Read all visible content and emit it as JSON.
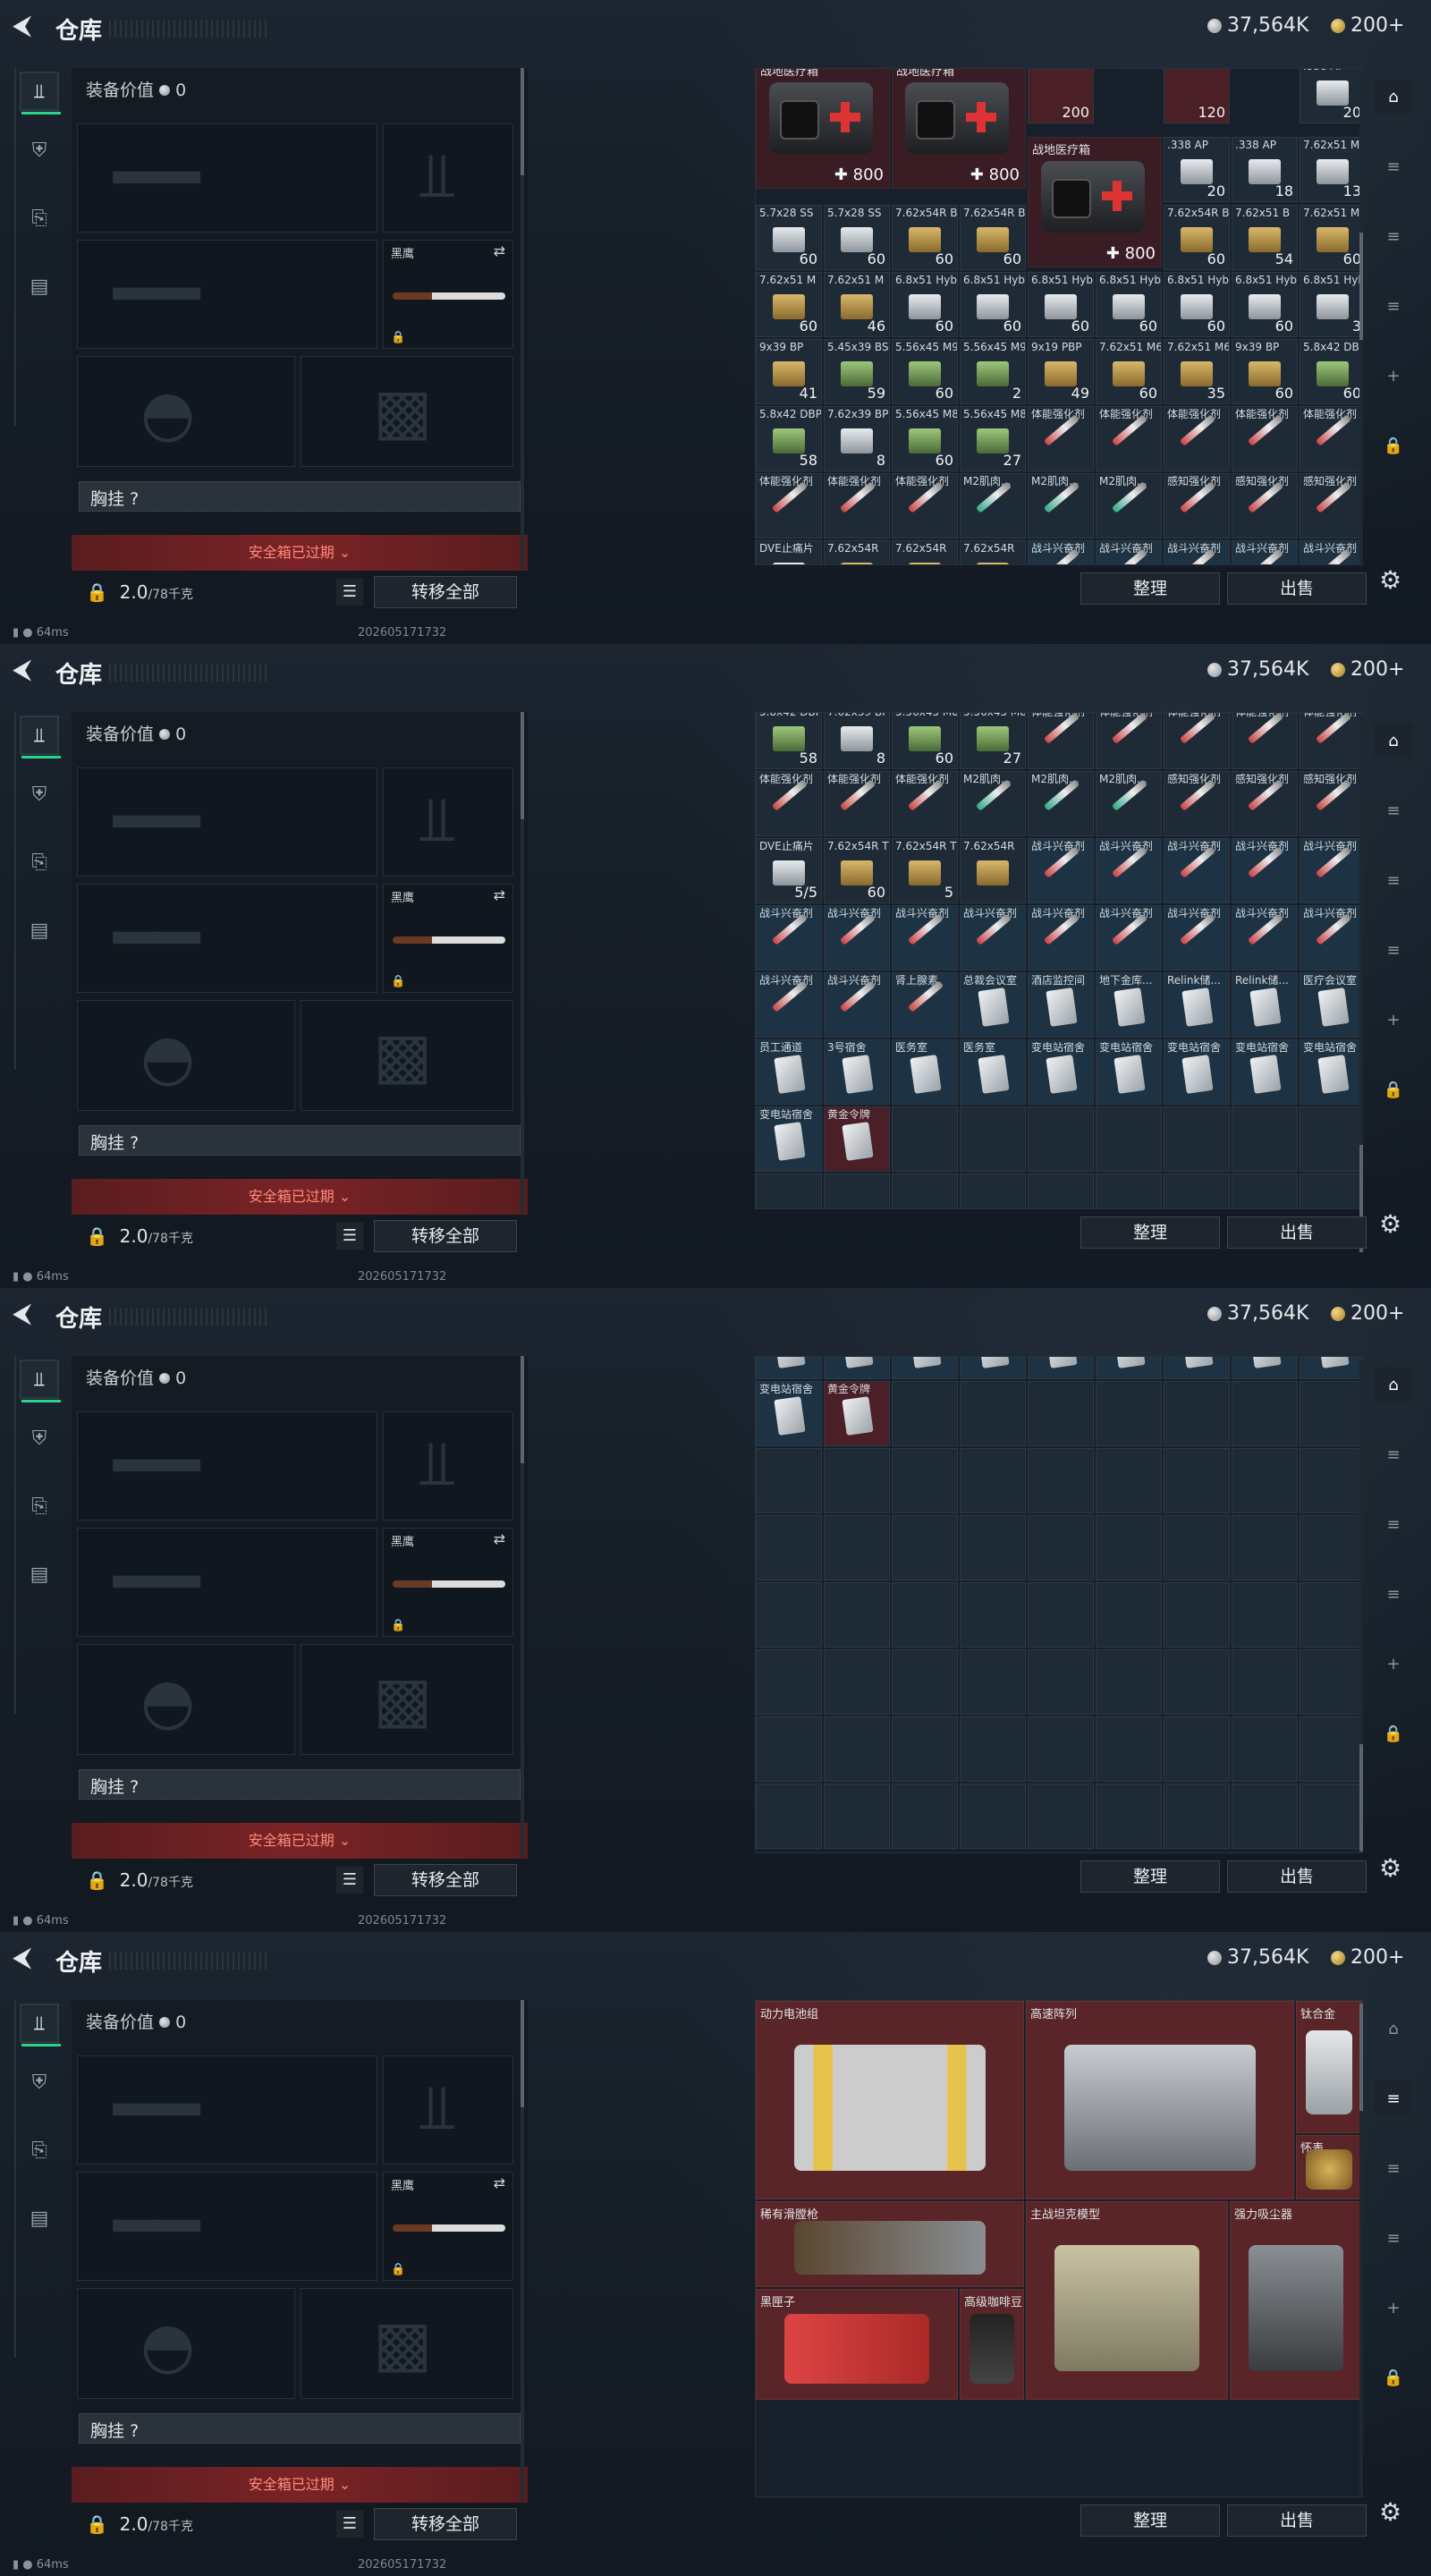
{
  "header": {
    "title": "仓库",
    "silver": "37,564K",
    "gold": "200+"
  },
  "left": {
    "value_label": "装备价值",
    "value": "0",
    "knife_label": "黑鹰",
    "chest_label": "胸挂",
    "chest_value": "?",
    "safebox_expired": "安全箱已过期",
    "weight": "2.0",
    "weight_max": "/78千克",
    "move_all": "转移全部"
  },
  "buttons": {
    "sort": "整理",
    "sell": "出售"
  },
  "status": {
    "ping": "64ms",
    "timestamp": "202605171732"
  },
  "icons": {
    "back": "back-arrow-icon",
    "gear": "gear-icon"
  },
  "shot1": {
    "large": [
      {
        "name": "战地医疗箱",
        "count": "800"
      },
      {
        "name": "战地医疗箱",
        "count": "800"
      },
      {
        "name": "战地医疗箱",
        "count": "800"
      }
    ],
    "misc": [
      {
        "name": "",
        "count": "200"
      },
      {
        "name": "",
        "count": "120"
      },
      {
        "name": ".338 AP",
        "count": "20"
      },
      {
        "name": ".338 AP",
        "count": "20"
      },
      {
        "name": ".338 AP",
        "count": "18"
      },
      {
        "name": "7.62x51 M",
        "count": "13"
      }
    ],
    "rows": [
      [
        {
          "n": "5.7x28 SS",
          "c": "60"
        },
        {
          "n": "5.7x28 SS",
          "c": "60"
        },
        {
          "n": "7.62x54R B",
          "c": "60"
        },
        {
          "n": "7.62x54R B",
          "c": "60"
        },
        {
          "n": "7.62x54R B",
          "c": "60"
        },
        {
          "n": "7.62x51 B",
          "c": "54"
        },
        {
          "n": "7.62x51 M",
          "c": "60"
        }
      ],
      [
        {
          "n": "7.62x51 M",
          "c": "60"
        },
        {
          "n": "7.62x51 M",
          "c": "46"
        },
        {
          "n": "6.8x51 Hyb",
          "c": "60"
        },
        {
          "n": "6.8x51 Hyb",
          "c": "60"
        },
        {
          "n": "6.8x51 Hyb",
          "c": "60"
        },
        {
          "n": "6.8x51 Hyb",
          "c": "60"
        },
        {
          "n": "6.8x51 Hyb",
          "c": "60"
        },
        {
          "n": "6.8x51 Hyb",
          "c": "60"
        },
        {
          "n": "6.8x51 Hyb",
          "c": "3"
        }
      ],
      [
        {
          "n": "9x39 BP",
          "c": "41"
        },
        {
          "n": "5.45x39 BS",
          "c": "59"
        },
        {
          "n": "5.56x45 M9",
          "c": "60"
        },
        {
          "n": "5.56x45 M9",
          "c": "2"
        },
        {
          "n": "9x19 PBP",
          "c": "49"
        },
        {
          "n": "7.62x51 M6",
          "c": "60"
        },
        {
          "n": "7.62x51 M6",
          "c": "35"
        },
        {
          "n": "9x39 BP",
          "c": "60"
        },
        {
          "n": "5.8x42 DBP",
          "c": "60"
        }
      ],
      [
        {
          "n": "5.8x42 DBP10",
          "c": "58"
        },
        {
          "n": "7.62x39 BP",
          "c": "8"
        },
        {
          "n": "5.56x45 M855A1",
          "c": "60"
        },
        {
          "n": "5.56x45 M855A1",
          "c": "27"
        },
        {
          "n": "体能强化剂",
          "c": ""
        },
        {
          "n": "体能强化剂",
          "c": ""
        },
        {
          "n": "体能强化剂",
          "c": ""
        },
        {
          "n": "体能强化剂",
          "c": ""
        },
        {
          "n": "体能强化剂",
          "c": ""
        }
      ],
      [
        {
          "n": "体能强化剂",
          "c": ""
        },
        {
          "n": "体能强化剂",
          "c": ""
        },
        {
          "n": "体能强化剂",
          "c": ""
        },
        {
          "n": "M2肌肉...",
          "c": ""
        },
        {
          "n": "M2肌肉...",
          "c": ""
        },
        {
          "n": "M2肌肉...",
          "c": ""
        },
        {
          "n": "感知强化剂",
          "c": ""
        },
        {
          "n": "感知强化剂",
          "c": ""
        },
        {
          "n": "感知强化剂",
          "c": ""
        }
      ],
      [
        {
          "n": "DVE止痛片",
          "c": ""
        },
        {
          "n": "7.62x54R",
          "c": ""
        },
        {
          "n": "7.62x54R",
          "c": ""
        },
        {
          "n": "7.62x54R",
          "c": ""
        },
        {
          "n": "战斗兴奋剂",
          "c": ""
        },
        {
          "n": "战斗兴奋剂",
          "c": ""
        },
        {
          "n": "战斗兴奋剂",
          "c": ""
        },
        {
          "n": "战斗兴奋剂",
          "c": ""
        },
        {
          "n": "战斗兴奋剂",
          "c": ""
        }
      ]
    ]
  },
  "shot2": {
    "rows": [
      [
        {
          "n": "5.8x42 DBP10",
          "c": "58"
        },
        {
          "n": "7.62x39 BP",
          "c": "8"
        },
        {
          "n": "5.56x45 M855A1",
          "c": "60"
        },
        {
          "n": "5.56x45 M855A1",
          "c": "27"
        },
        {
          "n": "体能强化剂",
          "c": ""
        },
        {
          "n": "体能强化剂",
          "c": ""
        },
        {
          "n": "体能强化剂",
          "c": ""
        },
        {
          "n": "体能强化剂",
          "c": ""
        },
        {
          "n": "体能强化剂",
          "c": ""
        }
      ],
      [
        {
          "n": "体能强化剂",
          "c": ""
        },
        {
          "n": "体能强化剂",
          "c": ""
        },
        {
          "n": "体能强化剂",
          "c": ""
        },
        {
          "n": "M2肌肉...",
          "c": ""
        },
        {
          "n": "M2肌肉...",
          "c": ""
        },
        {
          "n": "M2肌肉...",
          "c": ""
        },
        {
          "n": "感知强化剂",
          "c": ""
        },
        {
          "n": "感知强化剂",
          "c": ""
        },
        {
          "n": "感知强化剂",
          "c": ""
        }
      ],
      [
        {
          "n": "DVE止痛片",
          "c": "5/5"
        },
        {
          "n": "7.62x54R T",
          "c": "60"
        },
        {
          "n": "7.62x54R T",
          "c": "5"
        },
        {
          "n": "7.62x54R",
          "c": ""
        },
        {
          "n": "战斗兴奋剂",
          "c": ""
        },
        {
          "n": "战斗兴奋剂",
          "c": ""
        },
        {
          "n": "战斗兴奋剂",
          "c": ""
        },
        {
          "n": "战斗兴奋剂",
          "c": ""
        },
        {
          "n": "战斗兴奋剂",
          "c": ""
        }
      ],
      [
        {
          "n": "战斗兴奋剂",
          "c": ""
        },
        {
          "n": "战斗兴奋剂",
          "c": ""
        },
        {
          "n": "战斗兴奋剂",
          "c": ""
        },
        {
          "n": "战斗兴奋剂",
          "c": ""
        },
        {
          "n": "战斗兴奋剂",
          "c": ""
        },
        {
          "n": "战斗兴奋剂",
          "c": ""
        },
        {
          "n": "战斗兴奋剂",
          "c": ""
        },
        {
          "n": "战斗兴奋剂",
          "c": ""
        },
        {
          "n": "战斗兴奋剂",
          "c": ""
        }
      ],
      [
        {
          "n": "战斗兴奋剂",
          "c": ""
        },
        {
          "n": "战斗兴奋剂",
          "c": ""
        },
        {
          "n": "肾上腺素",
          "c": ""
        },
        {
          "n": "总裁会议室",
          "c": ""
        },
        {
          "n": "酒店监控间",
          "c": ""
        },
        {
          "n": "地下金库...",
          "c": ""
        },
        {
          "n": "Relink储...",
          "c": ""
        },
        {
          "n": "Relink储...",
          "c": ""
        },
        {
          "n": "医疗会议室",
          "c": ""
        }
      ],
      [
        {
          "n": "员工通道",
          "c": ""
        },
        {
          "n": "3号宿舍",
          "c": ""
        },
        {
          "n": "医务室",
          "c": ""
        },
        {
          "n": "医务室",
          "c": ""
        },
        {
          "n": "变电站宿舍",
          "c": ""
        },
        {
          "n": "变电站宿舍",
          "c": ""
        },
        {
          "n": "变电站宿舍",
          "c": ""
        },
        {
          "n": "变电站宿舍",
          "c": ""
        },
        {
          "n": "变电站宿舍",
          "c": ""
        }
      ],
      [
        {
          "n": "变电站宿舍",
          "c": ""
        },
        {
          "n": "黄金令牌",
          "c": ""
        }
      ]
    ]
  },
  "shot3": {
    "row": [
      {
        "n": "变电站宿舍",
        "c": ""
      },
      {
        "n": "黄金令牌",
        "c": ""
      }
    ]
  },
  "shot4": {
    "items": [
      {
        "name": "动力电池组"
      },
      {
        "name": "高速阵列"
      },
      {
        "name": "钛合金"
      },
      {
        "name": "怀表"
      },
      {
        "name": "稀有滑膛枪"
      },
      {
        "name": "主战坦克模型"
      },
      {
        "name": "强力吸尘器"
      },
      {
        "name": "黑匣子"
      },
      {
        "name": "高级咖啡豆"
      }
    ]
  }
}
